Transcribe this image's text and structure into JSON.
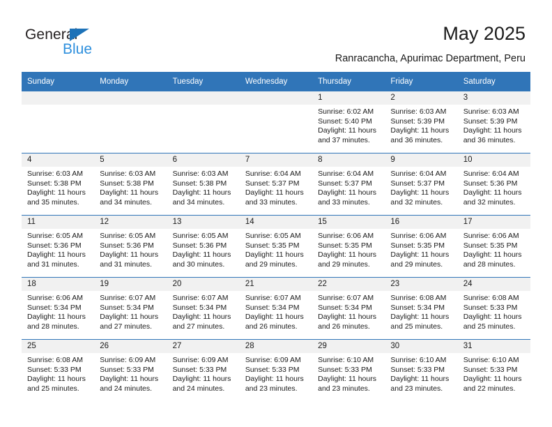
{
  "brand": {
    "name_part1": "General",
    "name_part2": "Blue",
    "triangle_icon": "blue-triangle-icon",
    "accent_color": "#2d8fdd",
    "dark_color": "#231f20"
  },
  "header": {
    "title": "May 2025",
    "subtitle": "Ranracancha, Apurimac Department, Peru",
    "header_bg_color": "#3075b8",
    "header_text_color": "#ffffff",
    "daycell_band_color": "#f1f1f1"
  },
  "weekdays": [
    "Sunday",
    "Monday",
    "Tuesday",
    "Wednesday",
    "Thursday",
    "Friday",
    "Saturday"
  ],
  "weeks": [
    [
      {
        "day": "",
        "sunrise": "",
        "sunset": "",
        "daylight_line1": "",
        "daylight_line2": ""
      },
      {
        "day": "",
        "sunrise": "",
        "sunset": "",
        "daylight_line1": "",
        "daylight_line2": ""
      },
      {
        "day": "",
        "sunrise": "",
        "sunset": "",
        "daylight_line1": "",
        "daylight_line2": ""
      },
      {
        "day": "",
        "sunrise": "",
        "sunset": "",
        "daylight_line1": "",
        "daylight_line2": ""
      },
      {
        "day": "1",
        "sunrise": "Sunrise: 6:02 AM",
        "sunset": "Sunset: 5:40 PM",
        "daylight_line1": "Daylight: 11 hours",
        "daylight_line2": "and 37 minutes."
      },
      {
        "day": "2",
        "sunrise": "Sunrise: 6:03 AM",
        "sunset": "Sunset: 5:39 PM",
        "daylight_line1": "Daylight: 11 hours",
        "daylight_line2": "and 36 minutes."
      },
      {
        "day": "3",
        "sunrise": "Sunrise: 6:03 AM",
        "sunset": "Sunset: 5:39 PM",
        "daylight_line1": "Daylight: 11 hours",
        "daylight_line2": "and 36 minutes."
      }
    ],
    [
      {
        "day": "4",
        "sunrise": "Sunrise: 6:03 AM",
        "sunset": "Sunset: 5:38 PM",
        "daylight_line1": "Daylight: 11 hours",
        "daylight_line2": "and 35 minutes."
      },
      {
        "day": "5",
        "sunrise": "Sunrise: 6:03 AM",
        "sunset": "Sunset: 5:38 PM",
        "daylight_line1": "Daylight: 11 hours",
        "daylight_line2": "and 34 minutes."
      },
      {
        "day": "6",
        "sunrise": "Sunrise: 6:03 AM",
        "sunset": "Sunset: 5:38 PM",
        "daylight_line1": "Daylight: 11 hours",
        "daylight_line2": "and 34 minutes."
      },
      {
        "day": "7",
        "sunrise": "Sunrise: 6:04 AM",
        "sunset": "Sunset: 5:37 PM",
        "daylight_line1": "Daylight: 11 hours",
        "daylight_line2": "and 33 minutes."
      },
      {
        "day": "8",
        "sunrise": "Sunrise: 6:04 AM",
        "sunset": "Sunset: 5:37 PM",
        "daylight_line1": "Daylight: 11 hours",
        "daylight_line2": "and 33 minutes."
      },
      {
        "day": "9",
        "sunrise": "Sunrise: 6:04 AM",
        "sunset": "Sunset: 5:37 PM",
        "daylight_line1": "Daylight: 11 hours",
        "daylight_line2": "and 32 minutes."
      },
      {
        "day": "10",
        "sunrise": "Sunrise: 6:04 AM",
        "sunset": "Sunset: 5:36 PM",
        "daylight_line1": "Daylight: 11 hours",
        "daylight_line2": "and 32 minutes."
      }
    ],
    [
      {
        "day": "11",
        "sunrise": "Sunrise: 6:05 AM",
        "sunset": "Sunset: 5:36 PM",
        "daylight_line1": "Daylight: 11 hours",
        "daylight_line2": "and 31 minutes."
      },
      {
        "day": "12",
        "sunrise": "Sunrise: 6:05 AM",
        "sunset": "Sunset: 5:36 PM",
        "daylight_line1": "Daylight: 11 hours",
        "daylight_line2": "and 31 minutes."
      },
      {
        "day": "13",
        "sunrise": "Sunrise: 6:05 AM",
        "sunset": "Sunset: 5:36 PM",
        "daylight_line1": "Daylight: 11 hours",
        "daylight_line2": "and 30 minutes."
      },
      {
        "day": "14",
        "sunrise": "Sunrise: 6:05 AM",
        "sunset": "Sunset: 5:35 PM",
        "daylight_line1": "Daylight: 11 hours",
        "daylight_line2": "and 29 minutes."
      },
      {
        "day": "15",
        "sunrise": "Sunrise: 6:06 AM",
        "sunset": "Sunset: 5:35 PM",
        "daylight_line1": "Daylight: 11 hours",
        "daylight_line2": "and 29 minutes."
      },
      {
        "day": "16",
        "sunrise": "Sunrise: 6:06 AM",
        "sunset": "Sunset: 5:35 PM",
        "daylight_line1": "Daylight: 11 hours",
        "daylight_line2": "and 29 minutes."
      },
      {
        "day": "17",
        "sunrise": "Sunrise: 6:06 AM",
        "sunset": "Sunset: 5:35 PM",
        "daylight_line1": "Daylight: 11 hours",
        "daylight_line2": "and 28 minutes."
      }
    ],
    [
      {
        "day": "18",
        "sunrise": "Sunrise: 6:06 AM",
        "sunset": "Sunset: 5:34 PM",
        "daylight_line1": "Daylight: 11 hours",
        "daylight_line2": "and 28 minutes."
      },
      {
        "day": "19",
        "sunrise": "Sunrise: 6:07 AM",
        "sunset": "Sunset: 5:34 PM",
        "daylight_line1": "Daylight: 11 hours",
        "daylight_line2": "and 27 minutes."
      },
      {
        "day": "20",
        "sunrise": "Sunrise: 6:07 AM",
        "sunset": "Sunset: 5:34 PM",
        "daylight_line1": "Daylight: 11 hours",
        "daylight_line2": "and 27 minutes."
      },
      {
        "day": "21",
        "sunrise": "Sunrise: 6:07 AM",
        "sunset": "Sunset: 5:34 PM",
        "daylight_line1": "Daylight: 11 hours",
        "daylight_line2": "and 26 minutes."
      },
      {
        "day": "22",
        "sunrise": "Sunrise: 6:07 AM",
        "sunset": "Sunset: 5:34 PM",
        "daylight_line1": "Daylight: 11 hours",
        "daylight_line2": "and 26 minutes."
      },
      {
        "day": "23",
        "sunrise": "Sunrise: 6:08 AM",
        "sunset": "Sunset: 5:34 PM",
        "daylight_line1": "Daylight: 11 hours",
        "daylight_line2": "and 25 minutes."
      },
      {
        "day": "24",
        "sunrise": "Sunrise: 6:08 AM",
        "sunset": "Sunset: 5:33 PM",
        "daylight_line1": "Daylight: 11 hours",
        "daylight_line2": "and 25 minutes."
      }
    ],
    [
      {
        "day": "25",
        "sunrise": "Sunrise: 6:08 AM",
        "sunset": "Sunset: 5:33 PM",
        "daylight_line1": "Daylight: 11 hours",
        "daylight_line2": "and 25 minutes."
      },
      {
        "day": "26",
        "sunrise": "Sunrise: 6:09 AM",
        "sunset": "Sunset: 5:33 PM",
        "daylight_line1": "Daylight: 11 hours",
        "daylight_line2": "and 24 minutes."
      },
      {
        "day": "27",
        "sunrise": "Sunrise: 6:09 AM",
        "sunset": "Sunset: 5:33 PM",
        "daylight_line1": "Daylight: 11 hours",
        "daylight_line2": "and 24 minutes."
      },
      {
        "day": "28",
        "sunrise": "Sunrise: 6:09 AM",
        "sunset": "Sunset: 5:33 PM",
        "daylight_line1": "Daylight: 11 hours",
        "daylight_line2": "and 23 minutes."
      },
      {
        "day": "29",
        "sunrise": "Sunrise: 6:10 AM",
        "sunset": "Sunset: 5:33 PM",
        "daylight_line1": "Daylight: 11 hours",
        "daylight_line2": "and 23 minutes."
      },
      {
        "day": "30",
        "sunrise": "Sunrise: 6:10 AM",
        "sunset": "Sunset: 5:33 PM",
        "daylight_line1": "Daylight: 11 hours",
        "daylight_line2": "and 23 minutes."
      },
      {
        "day": "31",
        "sunrise": "Sunrise: 6:10 AM",
        "sunset": "Sunset: 5:33 PM",
        "daylight_line1": "Daylight: 11 hours",
        "daylight_line2": "and 22 minutes."
      }
    ]
  ]
}
